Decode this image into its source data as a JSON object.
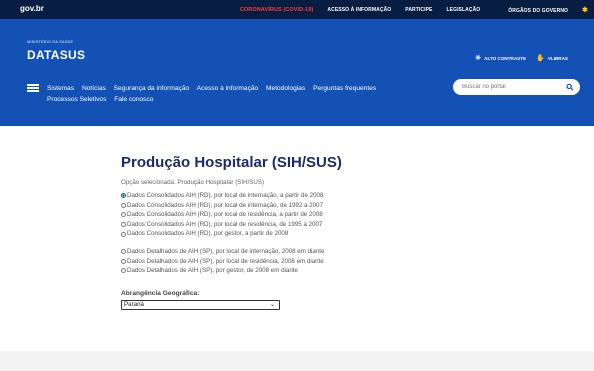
{
  "govbar": {
    "logo": "gov.br",
    "links": [
      "CORONAVÍRUS (COVID-19)",
      "ACESSO À INFORMAÇÃO",
      "PARTICIPE",
      "LEGISLAÇÃO",
      "ÓRGÃOS DO GOVERNO"
    ],
    "covid_color": "#ff3b3b",
    "bg_color": "#071d41"
  },
  "header": {
    "ministry": "MINISTÉRIO DA SAÚDE",
    "brand": "DATASUS",
    "contrast_label": "ALTO CONTRASTE",
    "vlibras_label": "VLIBRAS",
    "bg_color": "#1351b4"
  },
  "nav": {
    "items": [
      "Sistemas",
      "Notícias",
      "Segurança da informação",
      "Acesso à informação",
      "Metodologias",
      "Perguntas frequentes",
      "Processos Seletivos",
      "Fale conosco"
    ]
  },
  "search": {
    "placeholder": "Buscar no portal"
  },
  "main": {
    "title": "Produção Hospitalar (SIH/SUS)",
    "selected_text": "Opção selecionada: Produção Hospitalar (SIH/SUS)",
    "options_group1": [
      {
        "label": "Dados Consolidados AIH (RD), por local de internação, a partir de 2008",
        "checked": true
      },
      {
        "label": "Dados Consolidados AIH (RD), por local de internação, de 1992 a 2007",
        "checked": false
      },
      {
        "label": "Dados Consolidados AIH (RD), por local de residência, a partir de 2008",
        "checked": false
      },
      {
        "label": "Dados Consolidados AIH (RD), por local de residência, de 1995 a 2007",
        "checked": false
      },
      {
        "label": "Dados Consolidados AIH (RD), por gestor, a partir de 2008",
        "checked": false
      }
    ],
    "options_group2": [
      {
        "label": "Dados Detalhados de AIH (SP), por local de internação, 2008 em diante",
        "checked": false
      },
      {
        "label": "Dados Detalhados de AIH (SP), por local de residência, 2008 em diante",
        "checked": false
      },
      {
        "label": "Dados Detalhados de AIH (SP), por gestor, de 2008 em diante",
        "checked": false
      }
    ],
    "abrangencia_label": "Abrangência Geográfica:",
    "abrangencia_value": "Paraná"
  }
}
